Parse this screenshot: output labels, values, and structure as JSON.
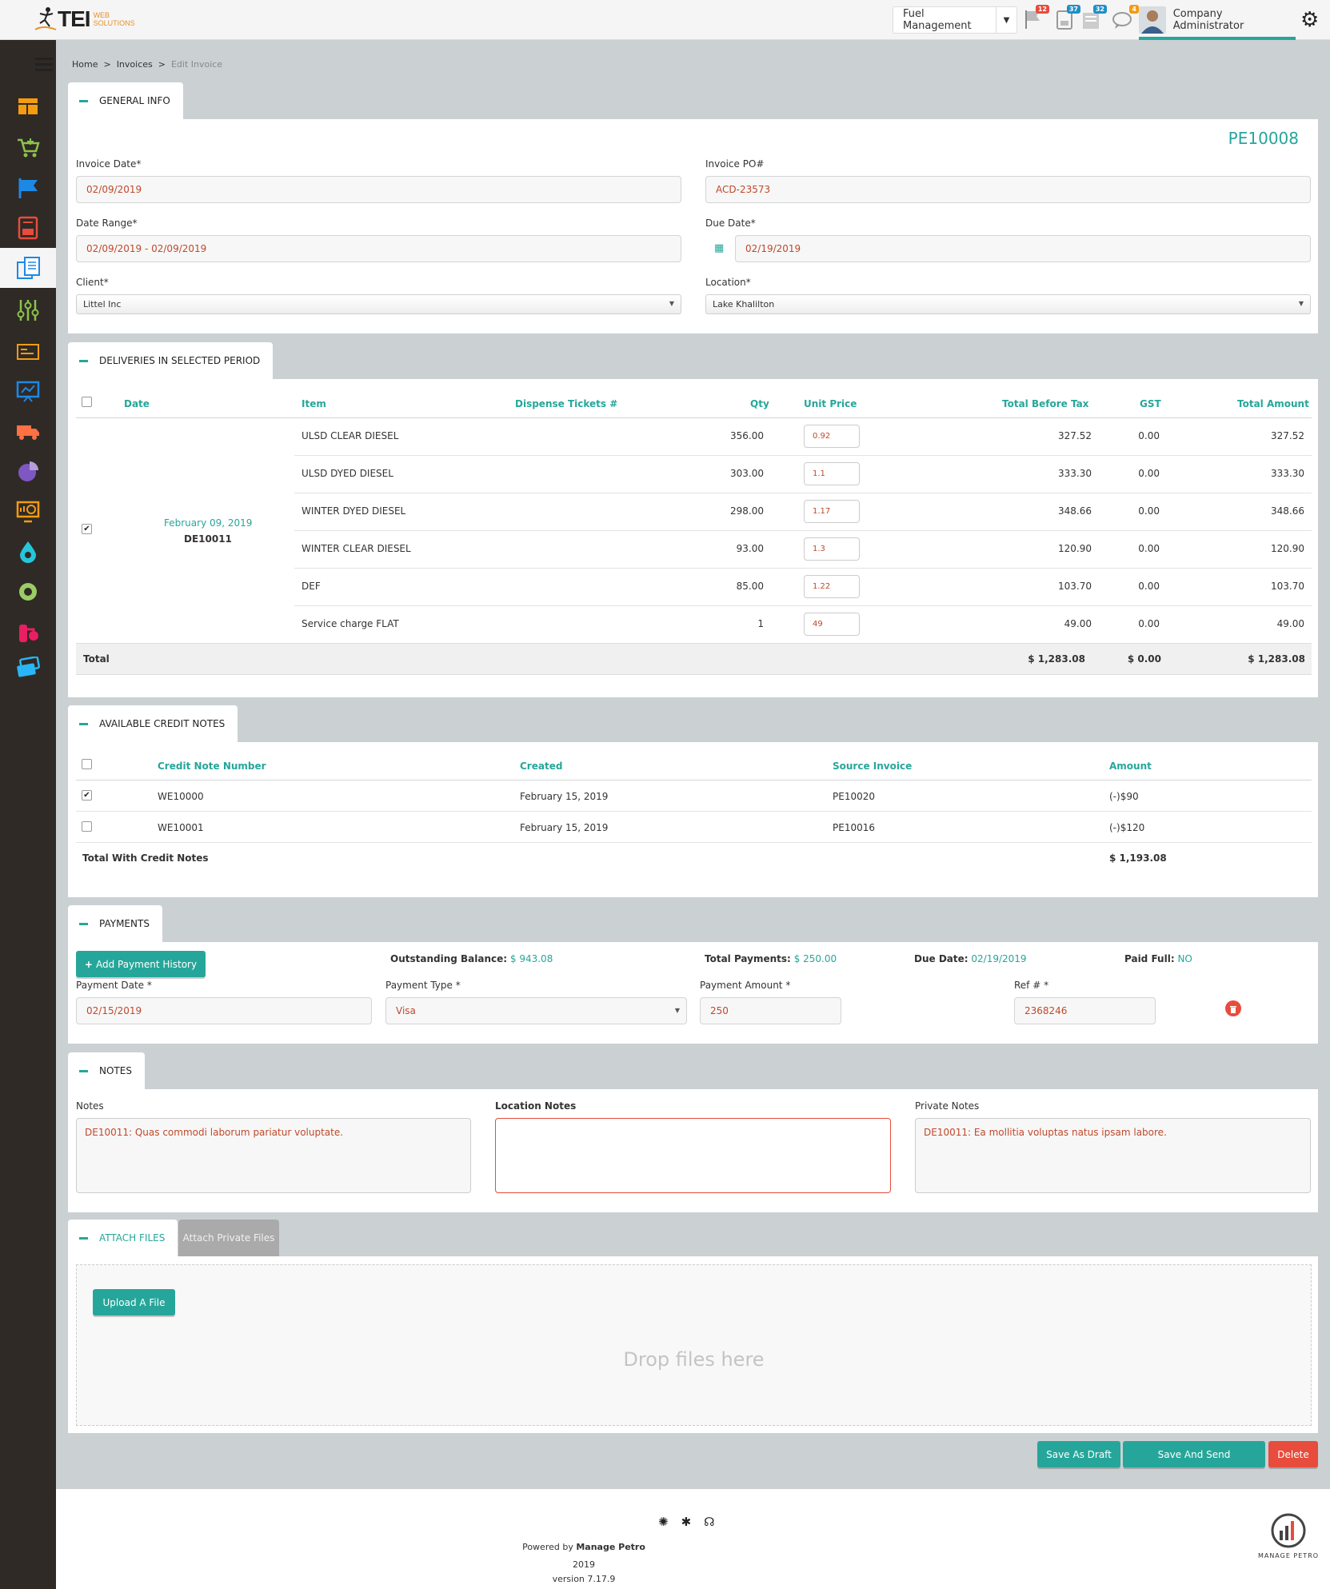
{
  "header": {
    "logo_text": "TEI",
    "logo_sub": "WEB SOLUTIONS",
    "module": "Fuel Management",
    "badges": [
      "12",
      "37",
      "32",
      "4"
    ],
    "user": "Company Administrator"
  },
  "breadcrumb": {
    "home": "Home",
    "invoices": "Invoices",
    "current": "Edit Invoice"
  },
  "general": {
    "tab": "GENERAL INFO",
    "invoice_no": "PE10008",
    "invoice_date_label": "Invoice Date*",
    "invoice_date": "02/09/2019",
    "po_label": "Invoice PO#",
    "po": "ACD-23573",
    "range_label": "Date Range*",
    "range": "02/09/2019 - 02/09/2019",
    "due_label": "Due Date*",
    "due": "02/19/2019",
    "client_label": "Client*",
    "client": "Littel Inc",
    "location_label": "Location*",
    "location": "Lake Khalilton"
  },
  "deliveries": {
    "tab": "DELIVERIES IN SELECTED PERIOD",
    "headers": {
      "date": "Date",
      "item": "Item",
      "tickets": "Dispense Tickets #",
      "qty": "Qty",
      "price": "Unit Price",
      "before": "Total Before Tax",
      "gst": "GST",
      "amount": "Total Amount"
    },
    "date": "February 09, 2019",
    "ref": "DE10011",
    "rows": [
      {
        "item": "ULSD CLEAR DIESEL",
        "qty": "356.00",
        "price": "0.92",
        "before": "327.52",
        "gst": "0.00",
        "amount": "327.52"
      },
      {
        "item": "ULSD DYED DIESEL",
        "qty": "303.00",
        "price": "1.1",
        "before": "333.30",
        "gst": "0.00",
        "amount": "333.30"
      },
      {
        "item": "WINTER DYED DIESEL",
        "qty": "298.00",
        "price": "1.17",
        "before": "348.66",
        "gst": "0.00",
        "amount": "348.66"
      },
      {
        "item": "WINTER CLEAR DIESEL",
        "qty": "93.00",
        "price": "1.3",
        "before": "120.90",
        "gst": "0.00",
        "amount": "120.90"
      },
      {
        "item": "DEF",
        "qty": "85.00",
        "price": "1.22",
        "before": "103.70",
        "gst": "0.00",
        "amount": "103.70"
      },
      {
        "item": "Service charge FLAT",
        "qty": "1",
        "price": "49",
        "before": "49.00",
        "gst": "0.00",
        "amount": "49.00"
      }
    ],
    "total_label": "Total",
    "total_before": "$ 1,283.08",
    "total_gst": "$ 0.00",
    "total_amount": "$ 1,283.08"
  },
  "credit": {
    "tab": "AVAILABLE CREDIT NOTES",
    "headers": {
      "number": "Credit Note Number",
      "created": "Created",
      "source": "Source Invoice",
      "amount": "Amount"
    },
    "rows": [
      {
        "number": "WE10000",
        "created": "February 15, 2019",
        "source": "PE10020",
        "amount": "(-)$90",
        "checked": "true"
      },
      {
        "number": "WE10001",
        "created": "February 15, 2019",
        "source": "PE10016",
        "amount": "(-)$120",
        "checked": "false"
      }
    ],
    "total_label": "Total With Credit Notes",
    "total": "$ 1,193.08"
  },
  "payments": {
    "tab": "PAYMENTS",
    "add_btn": "Add Payment History",
    "outstanding_label": "Outstanding Balance:",
    "outstanding": "$ 943.08",
    "total_label": "Total Payments:",
    "total": "$ 250.00",
    "due_label": "Due Date:",
    "due": "02/19/2019",
    "paid_label": "Paid Full:",
    "paid": "NO",
    "date_label": "Payment Date *",
    "date": "02/15/2019",
    "type_label": "Payment Type *",
    "type": "Visa",
    "amount_label": "Payment Amount *",
    "amount": "250",
    "ref_label": "Ref # *",
    "ref": "2368246"
  },
  "notes": {
    "tab": "NOTES",
    "notes_label": "Notes",
    "notes": "DE10011: Quas commodi laborum pariatur voluptate.",
    "location_label": "Location Notes",
    "location": "",
    "private_label": "Private Notes",
    "private": "DE10011: Ea mollitia voluptas natus ipsam labore."
  },
  "attach": {
    "tab": "ATTACH FILES",
    "tab2": "Attach Private Files",
    "upload": "Upload A File",
    "drop": "Drop files here"
  },
  "actions": {
    "draft": "Save As Draft",
    "send": "Save And Send",
    "delete": "Delete"
  },
  "footer": {
    "powered": "Powered by",
    "brand": "Manage Petro",
    "year": "2019",
    "version": "version 7.17.9",
    "logo_text": "MANAGE PETRO"
  },
  "colors": {
    "accent": "#26a69a",
    "danger": "#e74c3c",
    "sidebar": "#2f2a26"
  }
}
